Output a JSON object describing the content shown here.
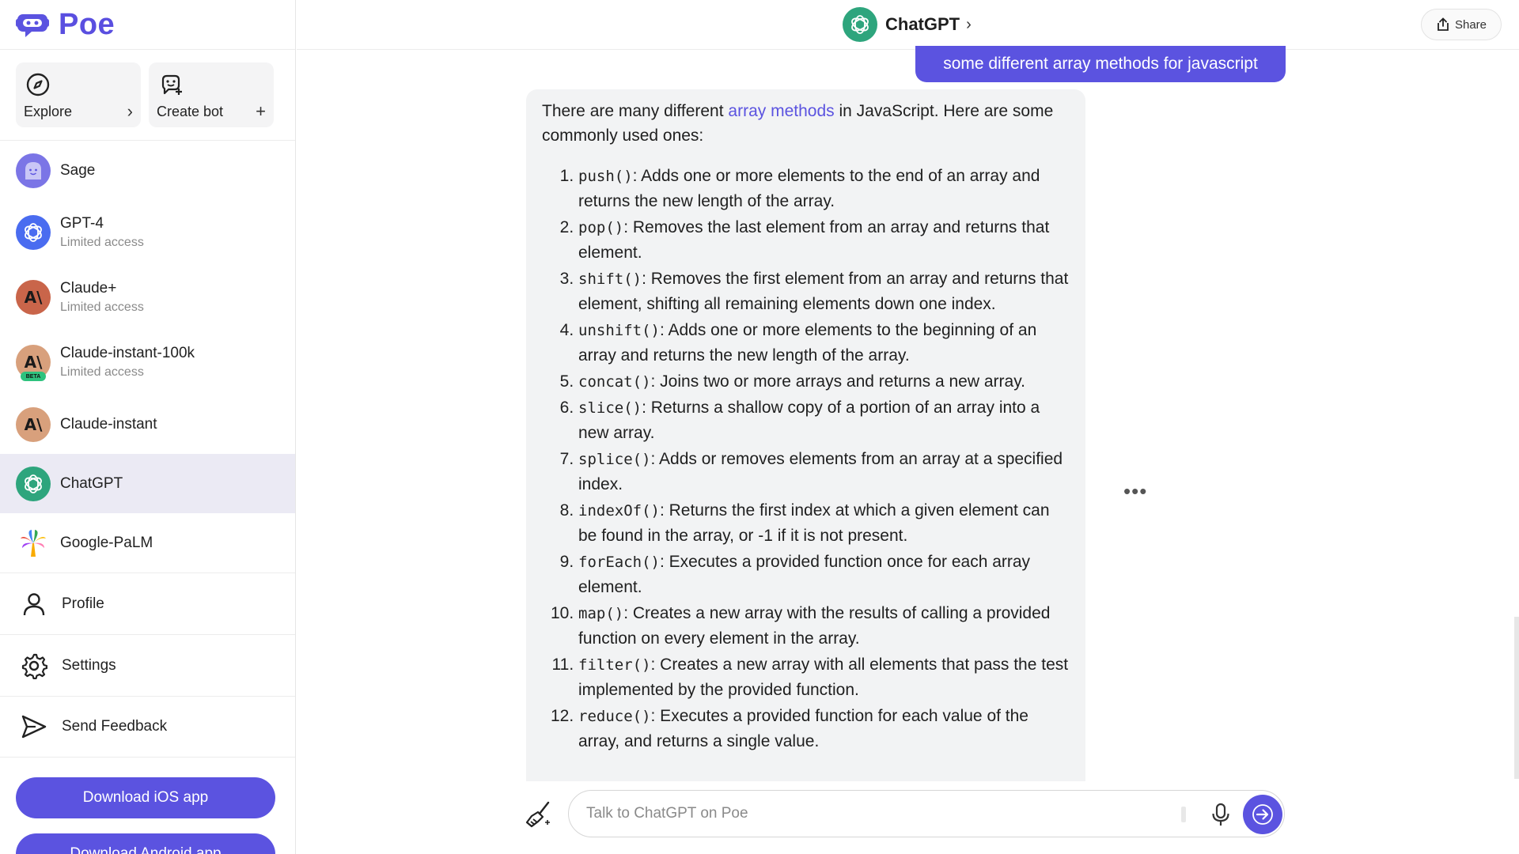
{
  "app": {
    "name": "Poe",
    "brand_color": "#5b53e0"
  },
  "sidebar": {
    "quick": [
      {
        "label": "Explore",
        "action": "›",
        "icon": "compass-icon"
      },
      {
        "label": "Create bot",
        "action": "+",
        "icon": "create-bot-icon"
      }
    ],
    "bots": [
      {
        "name": "Sage",
        "sub": "",
        "color": "#7b75e6"
      },
      {
        "name": "GPT-4",
        "sub": "Limited access",
        "color": "#4a6cf0"
      },
      {
        "name": "Claude+",
        "sub": "Limited access",
        "color": "#c9654a"
      },
      {
        "name": "Claude-instant-100k",
        "sub": "Limited access",
        "color": "#d8a07c",
        "badge": "BETA"
      },
      {
        "name": "Claude-instant",
        "sub": "",
        "color": "#d8a07c"
      },
      {
        "name": "ChatGPT",
        "sub": "",
        "color": "#2ea57d"
      },
      {
        "name": "Google-PaLM",
        "sub": "",
        "color": "#ffffff"
      }
    ],
    "menu": [
      {
        "label": "Profile",
        "icon": "profile-icon"
      },
      {
        "label": "Settings",
        "icon": "gear-icon"
      },
      {
        "label": "Send Feedback",
        "icon": "send-feedback-icon"
      }
    ],
    "download_ios": "Download iOS app",
    "download_android": "Download Android app"
  },
  "header": {
    "title": "ChatGPT",
    "chevron": "›",
    "share": "Share"
  },
  "chat": {
    "user_message": "some different array methods for javascript",
    "bot_intro_before": "There are many different ",
    "bot_intro_link": "array methods",
    "bot_intro_after": " in JavaScript. Here are some commonly used ones:",
    "methods": [
      {
        "code": "push()",
        "text": ": Adds one or more elements to the end of an array and returns the new length of the array."
      },
      {
        "code": "pop()",
        "text": ": Removes the last element from an array and returns that element."
      },
      {
        "code": "shift()",
        "text": ": Removes the first element from an array and returns that element, shifting all remaining elements down one index."
      },
      {
        "code": "unshift()",
        "text": ": Adds one or more elements to the beginning of an array and returns the new length of the array."
      },
      {
        "code": "concat()",
        "text": ": Joins two or more arrays and returns a new array."
      },
      {
        "code": "slice()",
        "text": ": Returns a shallow copy of a portion of an array into a new array."
      },
      {
        "code": "splice()",
        "text": ": Adds or removes elements from an array at a specified index."
      },
      {
        "code": "indexOf()",
        "text": ": Returns the first index at which a given element can be found in the array, or -1 if it is not present."
      },
      {
        "code": "forEach()",
        "text": ": Executes a provided function once for each array element."
      },
      {
        "code": "map()",
        "text": ": Creates a new array with the results of calling a provided function on every element in the array."
      },
      {
        "code": "filter()",
        "text": ": Creates a new array with all elements that pass the test implemented by the provided function."
      },
      {
        "code": "reduce()",
        "text": ": Executes a provided function for each value of the array, and returns a single value."
      }
    ],
    "more": "•••"
  },
  "composer": {
    "placeholder": "Talk to ChatGPT on Poe"
  }
}
